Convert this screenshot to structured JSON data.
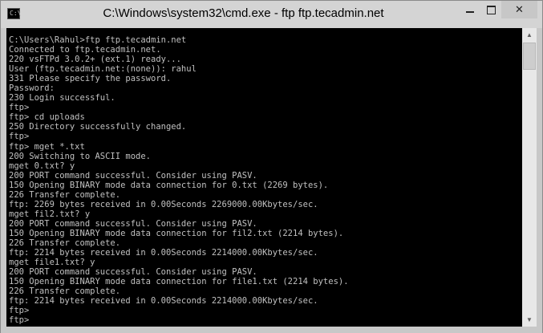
{
  "window": {
    "title": "C:\\Windows\\system32\\cmd.exe - ftp  ftp.tecadmin.net",
    "icon_label": "C:\\",
    "controls": {
      "minimize": "minimize-icon",
      "maximize": "maximize-icon",
      "close": "✕"
    }
  },
  "console": {
    "lines": [
      "C:\\Users\\Rahul>ftp ftp.tecadmin.net",
      "Connected to ftp.tecadmin.net.",
      "220 vsFTPd 3.0.2+ (ext.1) ready...",
      "User (ftp.tecadmin.net:(none)): rahul",
      "331 Please specify the password.",
      "Password:",
      "230 Login successful.",
      "ftp>",
      "ftp> cd uploads",
      "250 Directory successfully changed.",
      "ftp>",
      "ftp> mget *.txt",
      "200 Switching to ASCII mode.",
      "mget 0.txt? y",
      "200 PORT command successful. Consider using PASV.",
      "150 Opening BINARY mode data connection for 0.txt (2269 bytes).",
      "226 Transfer complete.",
      "ftp: 2269 bytes received in 0.00Seconds 2269000.00Kbytes/sec.",
      "mget fil2.txt? y",
      "200 PORT command successful. Consider using PASV.",
      "150 Opening BINARY mode data connection for fil2.txt (2214 bytes).",
      "226 Transfer complete.",
      "ftp: 2214 bytes received in 0.00Seconds 2214000.00Kbytes/sec.",
      "mget file1.txt? y",
      "200 PORT command successful. Consider using PASV.",
      "150 Opening BINARY mode data connection for file1.txt (2214 bytes).",
      "226 Transfer complete.",
      "ftp: 2214 bytes received in 0.00Seconds 2214000.00Kbytes/sec.",
      "ftp>",
      "ftp>"
    ]
  },
  "scrollbar": {
    "up": "scroll-up-icon",
    "down": "scroll-down-icon"
  },
  "colors": {
    "console_bg": "#000000",
    "console_fg": "#c0c0c0",
    "titlebar": "#d4d4d4"
  }
}
